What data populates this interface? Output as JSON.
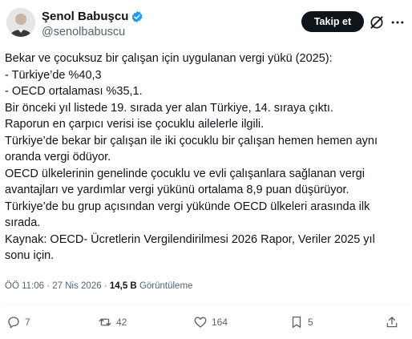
{
  "author": {
    "name": "Şenol Babuşcu",
    "handle": "@senolbabuscu",
    "verified": true
  },
  "header": {
    "follow_label": "Takip et",
    "icons": [
      "grok-icon",
      "more-icon"
    ]
  },
  "tweet": {
    "lines": [
      "Bekar ve çocuksuz bir çalışan için uygulanan vergi yükü (2025):",
      "- Türkiye’de %40,3",
      "- OECD ortalaması %35,1.",
      "Bir önceki yıl listede 19. sırada yer alan Türkiye, 14. sıraya çıktı.",
      "Raporun en çarpıcı verisi ise çocuklu ailelerle ilgili.",
      "Türkiye’de bekar bir çalışan ile iki çocuklu bir çalışan hemen hemen aynı",
      "oranda vergi ödüyor.",
      "OECD ülkelerinin genelinde çocuklu ve evli çalışanlara sağlanan vergi",
      "avantajları ve yardımlar vergi yükünü ortalama 8,9 puan düşürüyor.",
      "Türkiye’de bu grup açısından vergi yükünde OECD ülkeleri arasında ilk",
      "sırada.",
      "Kaynak: OECD- Ücretlerin Vergilendirilmesi 2026 Rapor, Veriler 2025 yıl",
      "sonu için."
    ]
  },
  "meta": {
    "time": "ÖÖ 11:06",
    "separator": " · ",
    "date": "27 Nis 2026",
    "views_count": "14,5 B",
    "views_label": "Görüntüleme"
  },
  "actions": {
    "reply": "7",
    "retweet": "42",
    "like": "164",
    "bookmark": "5"
  },
  "colors": {
    "text": "#0f1419",
    "secondary": "#536471",
    "verified": "#1d9bf0",
    "button_bg": "#0f1419"
  }
}
